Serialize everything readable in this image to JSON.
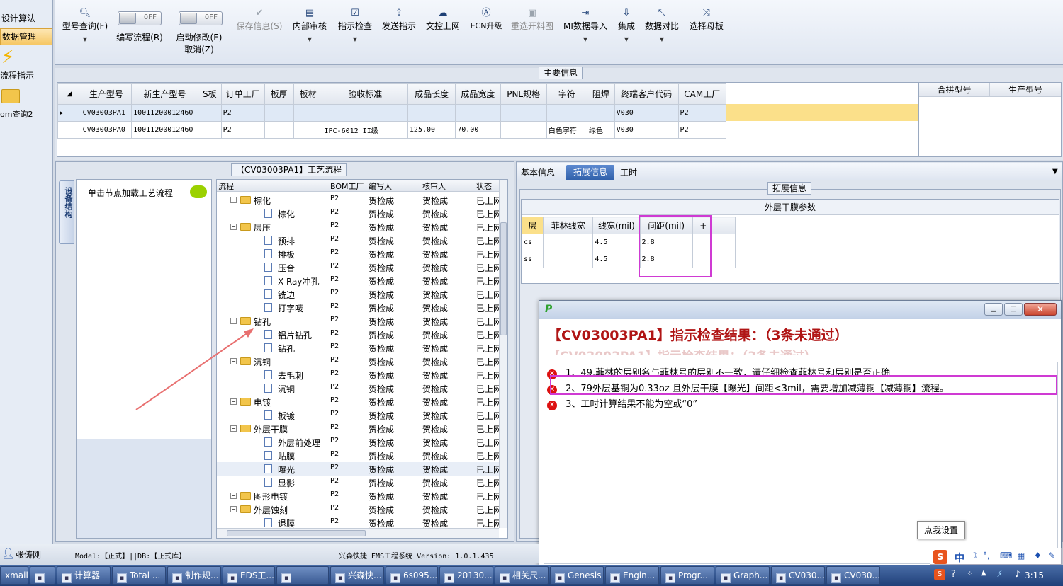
{
  "nav": {
    "items": [
      "设计算法",
      "数据管理",
      "流程指示",
      "om查询2"
    ]
  },
  "toolbar": {
    "buttons": [
      {
        "label": "型号查询(F)"
      },
      {
        "label": "编写流程(R)"
      },
      {
        "label": "启动修改(E)",
        "sub": "取消(Z)"
      },
      {
        "label": "保存信息(S)"
      },
      {
        "label": "内部审核"
      },
      {
        "label": "指示检查"
      },
      {
        "label": "发送指示"
      },
      {
        "label": "文控上网"
      },
      {
        "label": "ECN升级"
      },
      {
        "label": "重选开料图"
      },
      {
        "label": "MI数据导入"
      },
      {
        "label": "集成"
      },
      {
        "label": "数据对比"
      },
      {
        "label": "选择母板"
      }
    ],
    "toggle_off": "OFF"
  },
  "main_info": {
    "legend": "主要信息",
    "columns": [
      "生产型号",
      "新生产型号",
      "S板",
      "订单工厂",
      "板厚",
      "板材",
      "验收标准",
      "成品长度",
      "成品宽度",
      "PNL规格",
      "字符",
      "阻焊",
      "终端客户代码",
      "CAM工厂"
    ],
    "rows": [
      [
        "CV03003PA1",
        "10011200012460",
        "",
        "P2",
        "",
        "",
        "",
        "",
        "",
        "",
        "",
        "",
        "V030",
        "P2"
      ],
      [
        "CV03003PA0",
        "10011200012460",
        "",
        "P2",
        "",
        "",
        "IPC-6012 II级",
        "125.00",
        "70.00",
        "",
        "白色字符",
        "绿色",
        "V030",
        "P2"
      ]
    ],
    "right_columns": [
      "合拼型号",
      "生产型号"
    ]
  },
  "process": {
    "legend": "【CV03003PA1】工艺流程",
    "side_tab": "设备结构",
    "hint": "单击节点加载工艺流程",
    "columns": [
      "流程",
      "BOM工厂",
      "编写人",
      "核审人",
      "状态"
    ],
    "rows": [
      {
        "name": "棕化",
        "level": 1,
        "type": "folder"
      },
      {
        "name": "棕化",
        "level": 2,
        "type": "doc"
      },
      {
        "name": "层压",
        "level": 1,
        "type": "folder"
      },
      {
        "name": "预排",
        "level": 2,
        "type": "doc"
      },
      {
        "name": "排板",
        "level": 2,
        "type": "doc"
      },
      {
        "name": "压合",
        "level": 2,
        "type": "doc"
      },
      {
        "name": "X-Ray冲孔",
        "level": 2,
        "type": "doc"
      },
      {
        "name": "铣边",
        "level": 2,
        "type": "doc"
      },
      {
        "name": "打字唛",
        "level": 2,
        "type": "doc"
      },
      {
        "name": "钻孔",
        "level": 1,
        "type": "folder"
      },
      {
        "name": "铝片钻孔",
        "level": 2,
        "type": "doc"
      },
      {
        "name": "钻孔",
        "level": 2,
        "type": "doc"
      },
      {
        "name": "沉铜",
        "level": 1,
        "type": "folder"
      },
      {
        "name": "去毛刺",
        "level": 2,
        "type": "doc"
      },
      {
        "name": "沉铜",
        "level": 2,
        "type": "doc"
      },
      {
        "name": "电镀",
        "level": 1,
        "type": "folder"
      },
      {
        "name": "板镀",
        "level": 2,
        "type": "doc"
      },
      {
        "name": "外层干膜",
        "level": 1,
        "type": "folder"
      },
      {
        "name": "外层前处理",
        "level": 2,
        "type": "doc"
      },
      {
        "name": "贴膜",
        "level": 2,
        "type": "doc"
      },
      {
        "name": "曝光",
        "level": 2,
        "type": "doc"
      },
      {
        "name": "显影",
        "level": 2,
        "type": "doc"
      },
      {
        "name": "图形电镀",
        "level": 1,
        "type": "folder"
      },
      {
        "name": "外层蚀刻",
        "level": 1,
        "type": "folder"
      },
      {
        "name": "退膜",
        "level": 2,
        "type": "doc"
      }
    ],
    "cell_factory": "P2",
    "cell_writer": "贺检成",
    "cell_reviewer": "贺检成",
    "cell_status": "已上网"
  },
  "tabs": {
    "items": [
      "基本信息",
      "拓展信息",
      "工时"
    ]
  },
  "ext": {
    "legend": "拓展信息",
    "table_title": "外层干膜参数",
    "columns": [
      "层",
      "菲林线宽",
      "线宽(mil)",
      "间距(mil)",
      "+",
      "-"
    ],
    "rows": [
      [
        "cs",
        "",
        "4.5",
        "2.8",
        "",
        ""
      ],
      [
        "ss",
        "",
        "4.5",
        "2.8",
        "",
        ""
      ]
    ]
  },
  "dialog": {
    "title": "【CV03003PA1】指示检查结果：（3条未通过）",
    "shadow_title": "【CV03003PA1】指示检查结果：（3条未通过）",
    "messages": [
      "1、49.菲林的层别名与菲林号的层别不一致，请仔细检查菲林号和层别是否正确",
      "2、79外层基铜为0.33oz 且外层干膜【曝光】间距<3mil，需要增加减薄铜【减薄铜】流程。",
      "3、工时计算结果不能为空或“0”"
    ]
  },
  "tooltip": "点我设置",
  "status": {
    "user": "张俦刚",
    "model": "Model:【正式】||DB:【正式库】",
    "system": "兴森快捷 EMS工程系统 Version: 1.0.1.435"
  },
  "taskbar": {
    "items": [
      "xmail",
      "",
      "计算器",
      "Total ...",
      "制作规...",
      "EDS工...",
      "",
      "兴森快...",
      "6s095...",
      "20130...",
      "相关尺...",
      "Genesis",
      "Engin...",
      "Progr...",
      "Graph...",
      "CV030...",
      "CV030..."
    ],
    "ime": "中",
    "clock": "3:15"
  },
  "colors": {
    "accent": "#cf3ad3",
    "error": "#c8102e",
    "title_red": "#b01515",
    "selected_row": "#fbe08a"
  }
}
